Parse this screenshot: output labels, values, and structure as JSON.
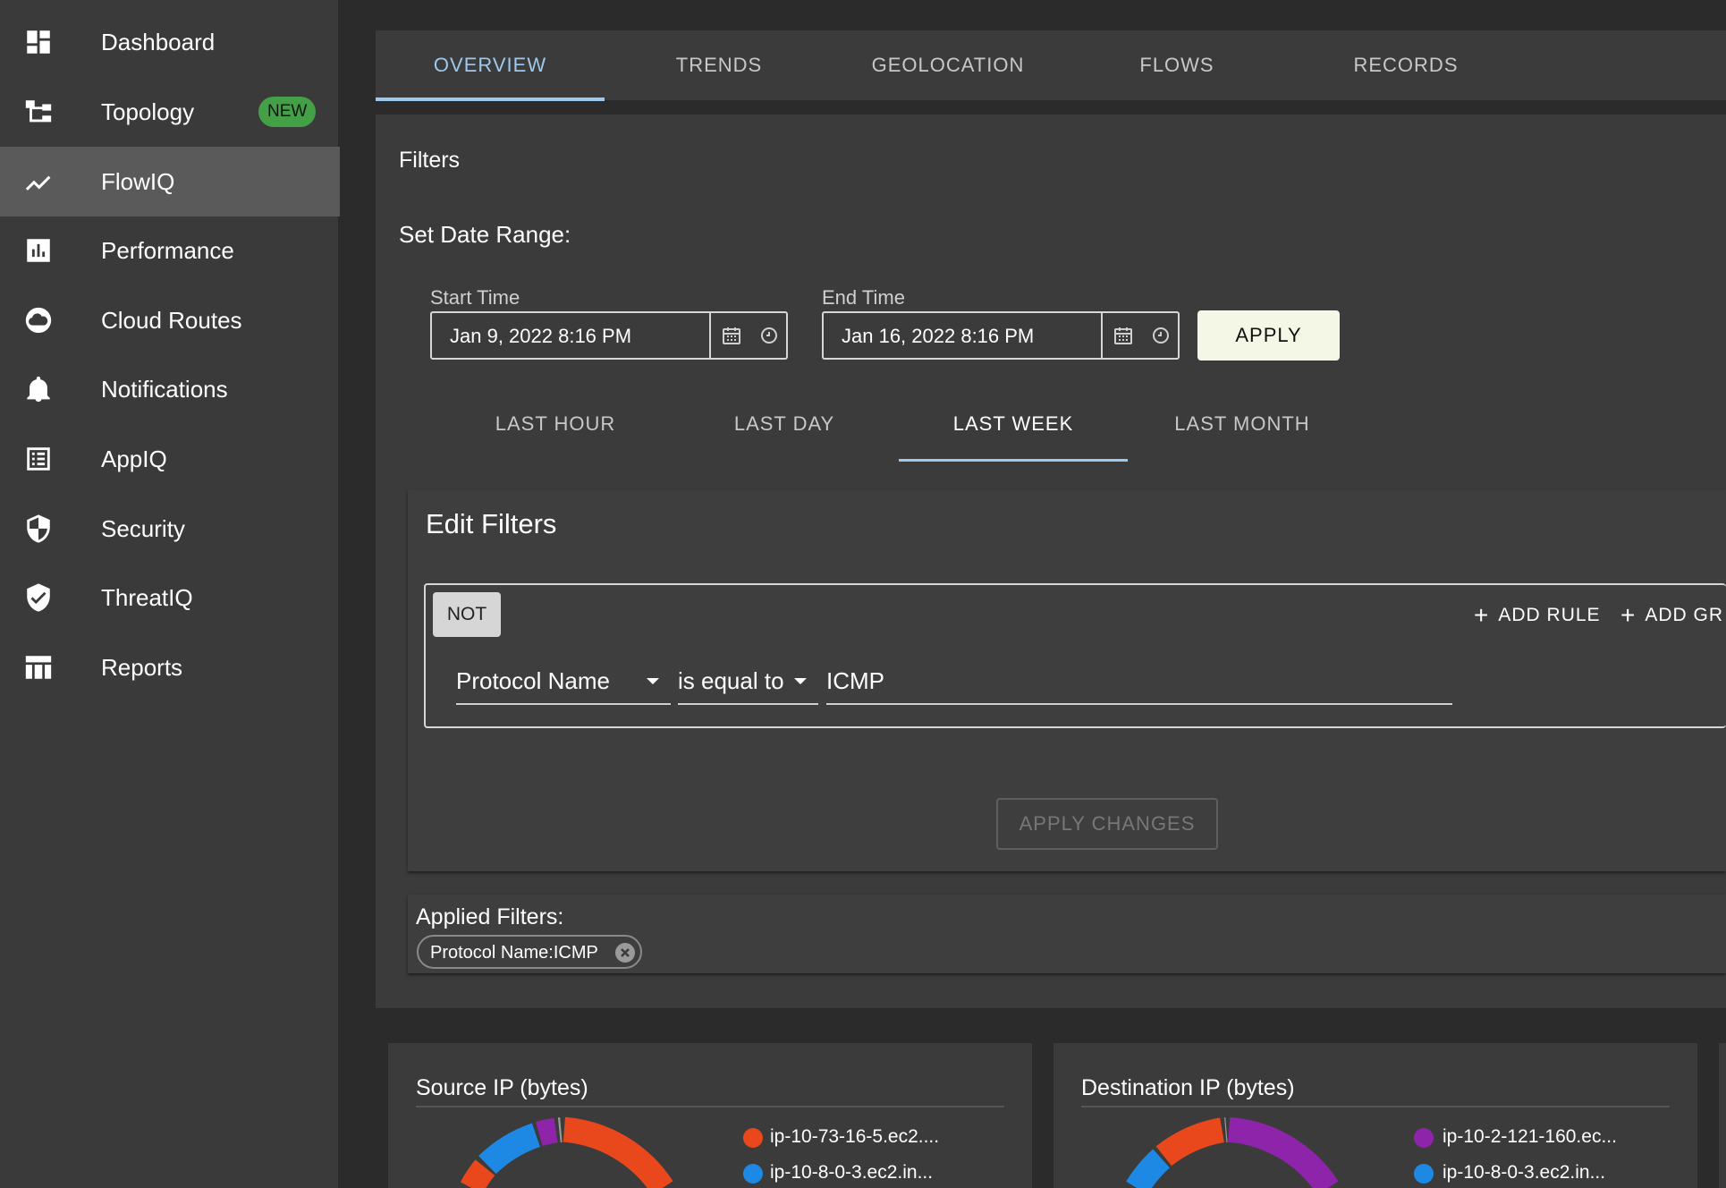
{
  "sidebar": {
    "items": [
      {
        "label": "Dashboard",
        "icon": "dashboard-icon"
      },
      {
        "label": "Topology",
        "icon": "topology-icon",
        "badge": "NEW"
      },
      {
        "label": "FlowIQ",
        "icon": "trending-icon",
        "active": true
      },
      {
        "label": "Performance",
        "icon": "bar-chart-icon"
      },
      {
        "label": "Cloud Routes",
        "icon": "cloud-icon"
      },
      {
        "label": "Notifications",
        "icon": "bell-icon"
      },
      {
        "label": "AppIQ",
        "icon": "list-icon"
      },
      {
        "label": "Security",
        "icon": "shield-icon"
      },
      {
        "label": "ThreatIQ",
        "icon": "shield-check-icon"
      },
      {
        "label": "Reports",
        "icon": "table-icon"
      }
    ]
  },
  "tabs": [
    "OVERVIEW",
    "TRENDS",
    "GEOLOCATION",
    "FLOWS",
    "RECORDS"
  ],
  "active_tab": "OVERVIEW",
  "filters": {
    "title": "Filters",
    "date_range_label": "Set Date Range:",
    "start_label": "Start Time",
    "start_value": "Jan 9, 2022 8:16 PM",
    "end_label": "End Time",
    "end_value": "Jan 16, 2022 8:16 PM",
    "apply_label": "APPLY",
    "range_tabs": [
      "LAST HOUR",
      "LAST DAY",
      "LAST WEEK",
      "LAST MONTH"
    ],
    "active_range": "LAST WEEK"
  },
  "edit_filters": {
    "title": "Edit Filters",
    "not_label": "NOT",
    "add_rule": "ADD RULE",
    "add_group": "ADD GR",
    "field": "Protocol Name",
    "operator": "is equal to",
    "value": "ICMP",
    "apply_changes": "APPLY CHANGES"
  },
  "applied_filters": {
    "label": "Applied Filters:",
    "chips": [
      "Protocol Name:ICMP"
    ]
  },
  "charts": [
    {
      "title": "Source IP (bytes)",
      "legend": [
        {
          "label": "ip-10-73-16-5.ec2....",
          "color": "#e8481c"
        },
        {
          "label": "ip-10-8-0-3.ec2.in...",
          "color": "#1e88e5"
        }
      ]
    },
    {
      "title": "Destination IP (bytes)",
      "legend": [
        {
          "label": "ip-10-2-121-160.ec...",
          "color": "#8e24aa"
        },
        {
          "label": "ip-10-8-0-3.ec2.in...",
          "color": "#1e88e5"
        }
      ]
    }
  ],
  "colors": {
    "accent": "#9ec9ee",
    "badge": "#43a047",
    "orange": "#e8481c",
    "blue": "#1e88e5",
    "purple": "#8e24aa"
  }
}
